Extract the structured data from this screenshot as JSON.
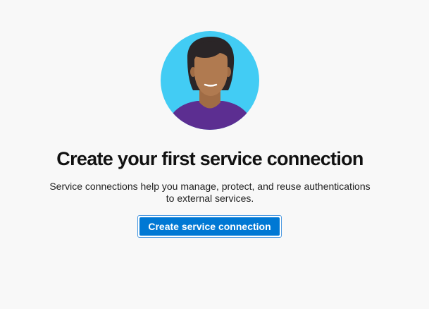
{
  "empty_state": {
    "illustration": "person-avatar-illustration",
    "title": "Create your first service connection",
    "description_line1": "Service connections help you manage, protect, and reuse authentications",
    "description_line2": "to external services.",
    "button_label": "Create service connection"
  },
  "colors": {
    "page_background": "#f8f8f8",
    "avatar_background": "#42ccf4",
    "button_primary": "#0078d4",
    "shirt": "#5c2e91",
    "skin": "#b07a50",
    "hair": "#2a2527"
  }
}
